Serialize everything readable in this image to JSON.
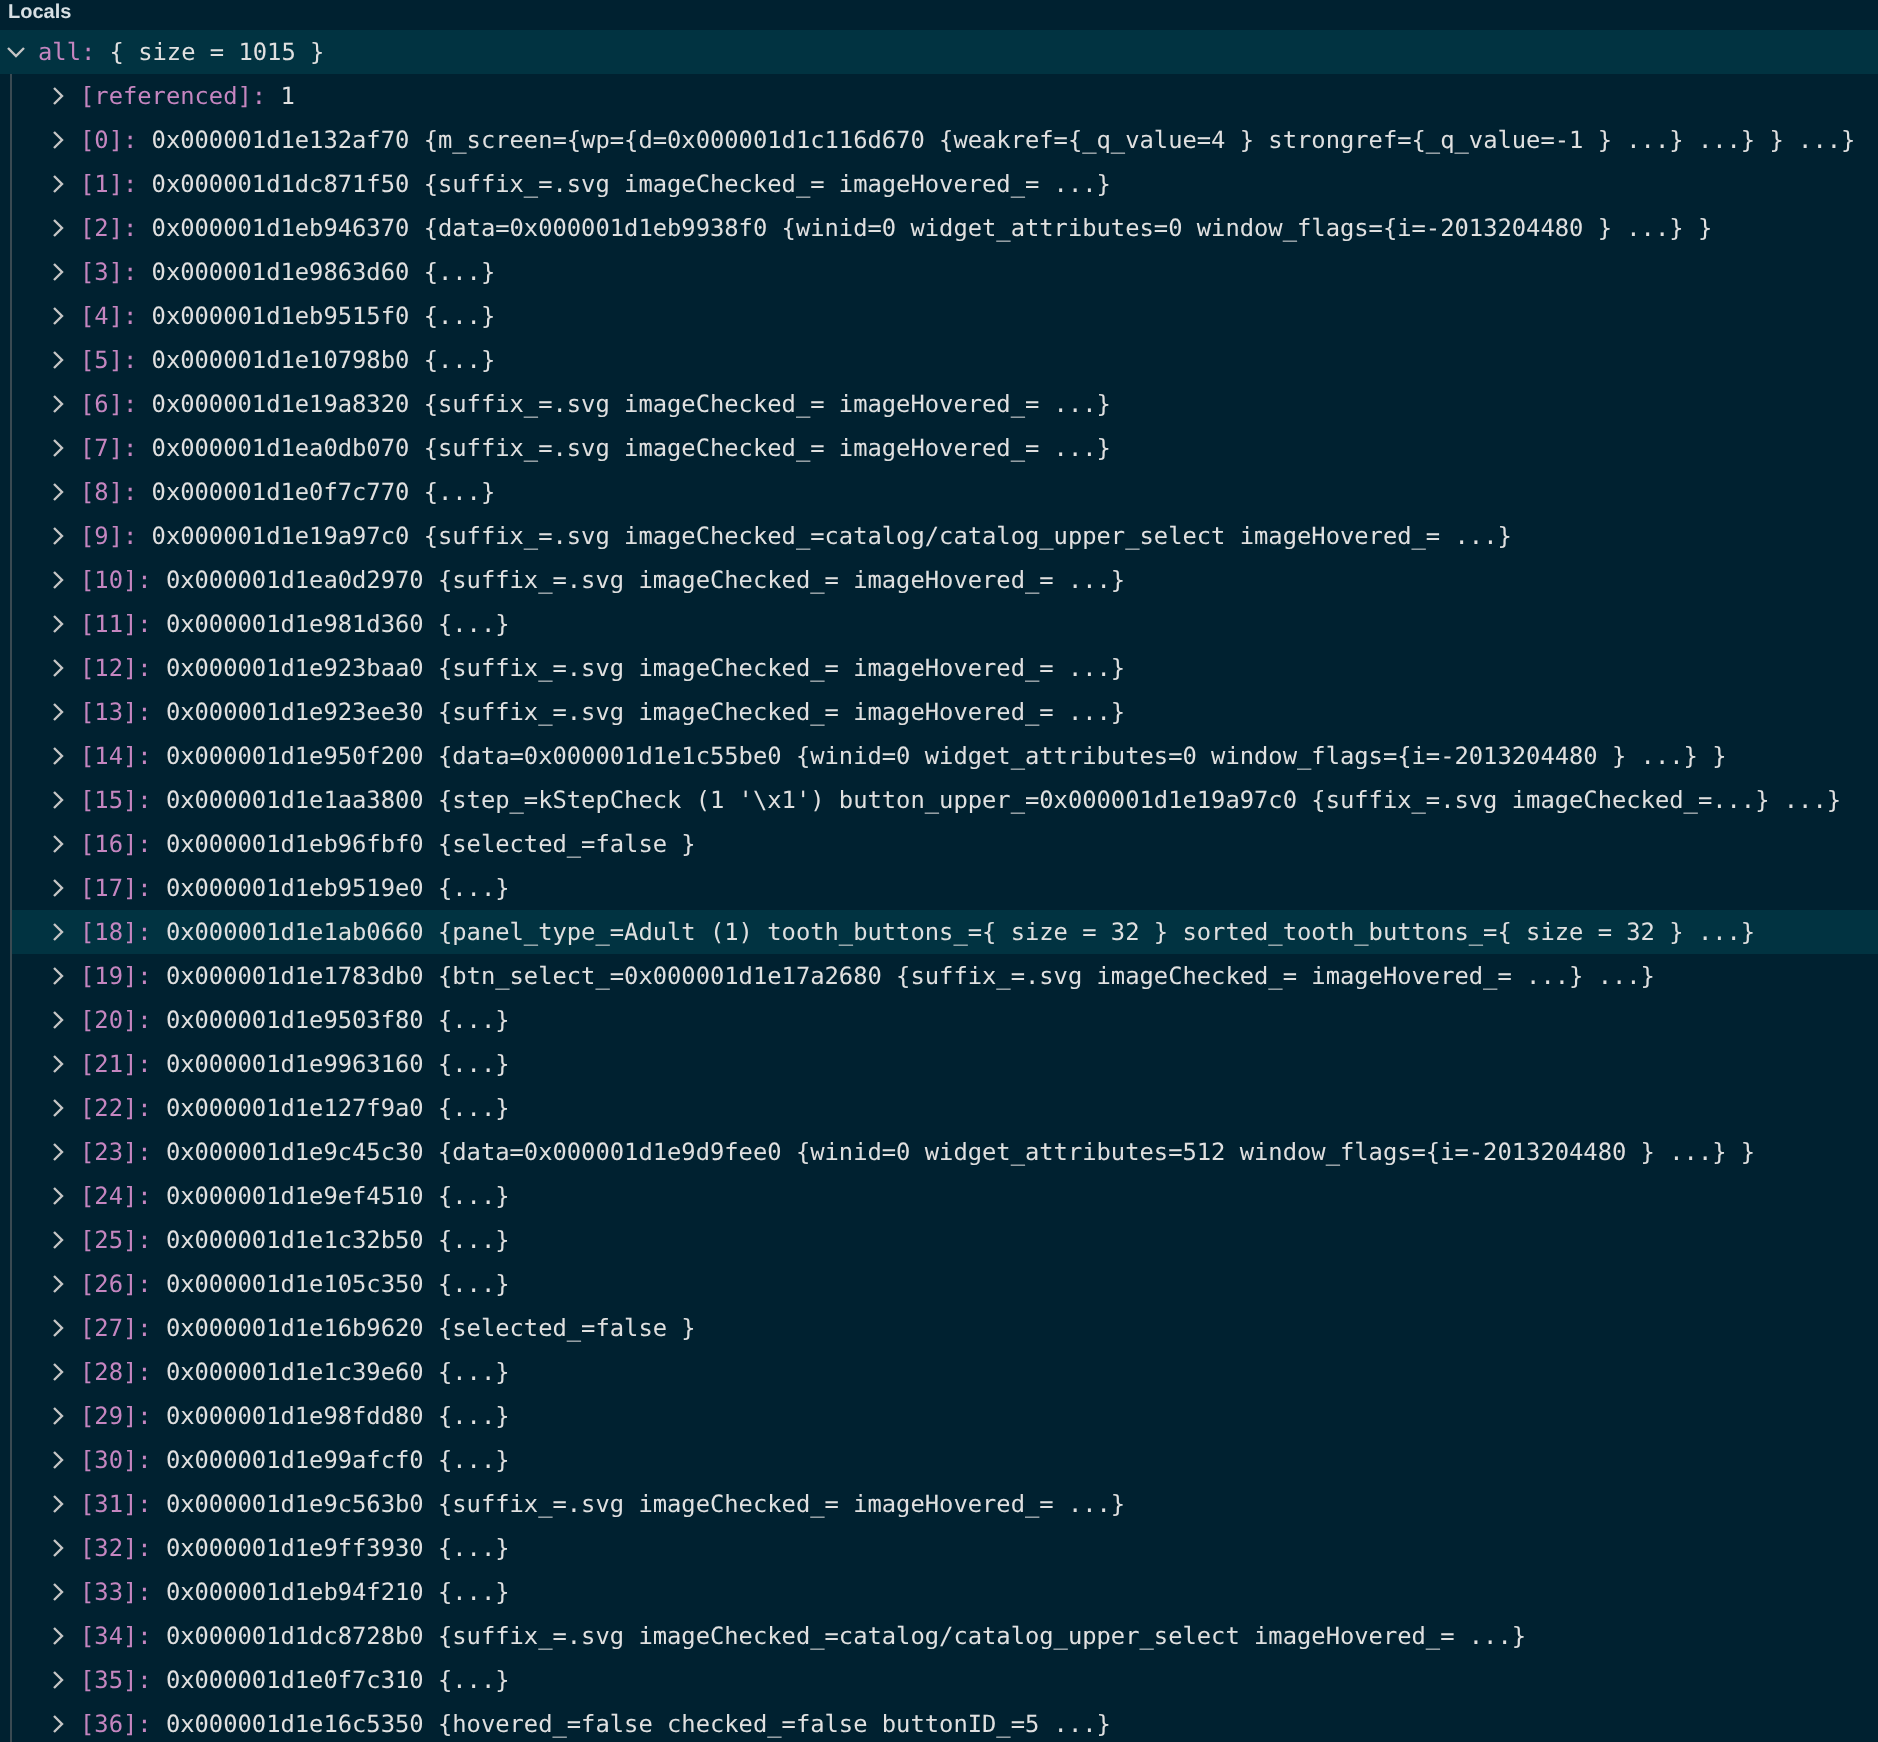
{
  "panel": {
    "title": "Locals"
  },
  "tree": [
    {
      "name": "all:",
      "value": "{ size = 1015 }",
      "expanded": true,
      "selected": true,
      "children": [
        {
          "name": "[referenced]:",
          "value": "1",
          "expanded": false,
          "selected": false
        },
        {
          "name": "[0]:",
          "value": "0x000001d1e132af70 {m_screen={wp={d=0x000001d1c116d670 {weakref={_q_value=4 } strongref={_q_value=-1 } ...} ...} } ...}",
          "expanded": false,
          "selected": false
        },
        {
          "name": "[1]:",
          "value": "0x000001d1dc871f50 {suffix_=.svg imageChecked_= imageHovered_= ...}",
          "expanded": false,
          "selected": false
        },
        {
          "name": "[2]:",
          "value": "0x000001d1eb946370 {data=0x000001d1eb9938f0 {winid=0 widget_attributes=0 window_flags={i=-2013204480 } ...} }",
          "expanded": false,
          "selected": false
        },
        {
          "name": "[3]:",
          "value": "0x000001d1e9863d60 {...}",
          "expanded": false,
          "selected": false
        },
        {
          "name": "[4]:",
          "value": "0x000001d1eb9515f0 {...}",
          "expanded": false,
          "selected": false
        },
        {
          "name": "[5]:",
          "value": "0x000001d1e10798b0 {...}",
          "expanded": false,
          "selected": false
        },
        {
          "name": "[6]:",
          "value": "0x000001d1e19a8320 {suffix_=.svg imageChecked_= imageHovered_= ...}",
          "expanded": false,
          "selected": false
        },
        {
          "name": "[7]:",
          "value": "0x000001d1ea0db070 {suffix_=.svg imageChecked_= imageHovered_= ...}",
          "expanded": false,
          "selected": false
        },
        {
          "name": "[8]:",
          "value": "0x000001d1e0f7c770 {...}",
          "expanded": false,
          "selected": false
        },
        {
          "name": "[9]:",
          "value": "0x000001d1e19a97c0 {suffix_=.svg imageChecked_=catalog/catalog_upper_select imageHovered_= ...}",
          "expanded": false,
          "selected": false
        },
        {
          "name": "[10]:",
          "value": "0x000001d1ea0d2970 {suffix_=.svg imageChecked_= imageHovered_= ...}",
          "expanded": false,
          "selected": false
        },
        {
          "name": "[11]:",
          "value": "0x000001d1e981d360 {...}",
          "expanded": false,
          "selected": false
        },
        {
          "name": "[12]:",
          "value": "0x000001d1e923baa0 {suffix_=.svg imageChecked_= imageHovered_= ...}",
          "expanded": false,
          "selected": false
        },
        {
          "name": "[13]:",
          "value": "0x000001d1e923ee30 {suffix_=.svg imageChecked_= imageHovered_= ...}",
          "expanded": false,
          "selected": false
        },
        {
          "name": "[14]:",
          "value": "0x000001d1e950f200 {data=0x000001d1e1c55be0 {winid=0 widget_attributes=0 window_flags={i=-2013204480 } ...} }",
          "expanded": false,
          "selected": false
        },
        {
          "name": "[15]:",
          "value": "0x000001d1e1aa3800 {step_=kStepCheck (1 '\\x1') button_upper_=0x000001d1e19a97c0 {suffix_=.svg imageChecked_=...} ...}",
          "expanded": false,
          "selected": false
        },
        {
          "name": "[16]:",
          "value": "0x000001d1eb96fbf0 {selected_=false }",
          "expanded": false,
          "selected": false
        },
        {
          "name": "[17]:",
          "value": "0x000001d1eb9519e0 {...}",
          "expanded": false,
          "selected": false
        },
        {
          "name": "[18]:",
          "value": "0x000001d1e1ab0660 {panel_type_=Adult (1) tooth_buttons_={ size = 32 } sorted_tooth_buttons_={ size = 32 } ...}",
          "expanded": false,
          "selected": true
        },
        {
          "name": "[19]:",
          "value": "0x000001d1e1783db0 {btn_select_=0x000001d1e17a2680 {suffix_=.svg imageChecked_= imageHovered_= ...} ...}",
          "expanded": false,
          "selected": false
        },
        {
          "name": "[20]:",
          "value": "0x000001d1e9503f80 {...}",
          "expanded": false,
          "selected": false
        },
        {
          "name": "[21]:",
          "value": "0x000001d1e9963160 {...}",
          "expanded": false,
          "selected": false
        },
        {
          "name": "[22]:",
          "value": "0x000001d1e127f9a0 {...}",
          "expanded": false,
          "selected": false
        },
        {
          "name": "[23]:",
          "value": "0x000001d1e9c45c30 {data=0x000001d1e9d9fee0 {winid=0 widget_attributes=512 window_flags={i=-2013204480 } ...} }",
          "expanded": false,
          "selected": false
        },
        {
          "name": "[24]:",
          "value": "0x000001d1e9ef4510 {...}",
          "expanded": false,
          "selected": false
        },
        {
          "name": "[25]:",
          "value": "0x000001d1e1c32b50 {...}",
          "expanded": false,
          "selected": false
        },
        {
          "name": "[26]:",
          "value": "0x000001d1e105c350 {...}",
          "expanded": false,
          "selected": false
        },
        {
          "name": "[27]:",
          "value": "0x000001d1e16b9620 {selected_=false }",
          "expanded": false,
          "selected": false
        },
        {
          "name": "[28]:",
          "value": "0x000001d1e1c39e60 {...}",
          "expanded": false,
          "selected": false
        },
        {
          "name": "[29]:",
          "value": "0x000001d1e98fdd80 {...}",
          "expanded": false,
          "selected": false
        },
        {
          "name": "[30]:",
          "value": "0x000001d1e99afcf0 {...}",
          "expanded": false,
          "selected": false
        },
        {
          "name": "[31]:",
          "value": "0x000001d1e9c563b0 {suffix_=.svg imageChecked_= imageHovered_= ...}",
          "expanded": false,
          "selected": false
        },
        {
          "name": "[32]:",
          "value": "0x000001d1e9ff3930 {...}",
          "expanded": false,
          "selected": false
        },
        {
          "name": "[33]:",
          "value": "0x000001d1eb94f210 {...}",
          "expanded": false,
          "selected": false
        },
        {
          "name": "[34]:",
          "value": "0x000001d1dc8728b0 {suffix_=.svg imageChecked_=catalog/catalog_upper_select imageHovered_= ...}",
          "expanded": false,
          "selected": false
        },
        {
          "name": "[35]:",
          "value": "0x000001d1e0f7c310 {...}",
          "expanded": false,
          "selected": false
        },
        {
          "name": "[36]:",
          "value": "0x000001d1e16c5350 {hovered_=false checked_=false buttonID_=5 ...}",
          "expanded": false,
          "selected": false
        }
      ]
    }
  ]
}
